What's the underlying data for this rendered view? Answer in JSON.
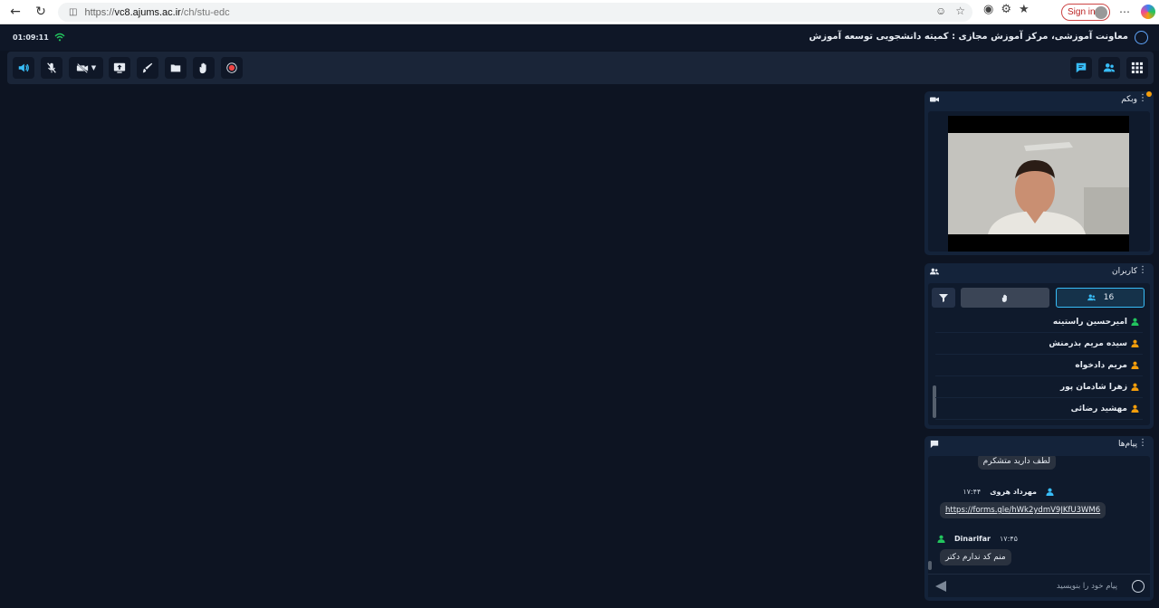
{
  "browser": {
    "url_scheme": "https://",
    "url_host": "vc8.ajums.ac.ir",
    "url_path": "/ch/stu-edc",
    "signin_label": "Sign in"
  },
  "header": {
    "timer": "01:09:11",
    "room_title": "معاونت آموزشی، مرکز آموزش مجازی : کمیته دانشجویی توسعه آموزش"
  },
  "panels": {
    "webcam": {
      "title": "وبکم"
    },
    "users": {
      "title": "کاربران",
      "count": "16",
      "list": [
        {
          "name": "امیرحسین راستینه",
          "status_color": "#22c55e"
        },
        {
          "name": "سیده مریم بذرمنش",
          "status_color": "#f59e0b"
        },
        {
          "name": "مریم دادخواه",
          "status_color": "#f59e0b"
        },
        {
          "name": "زهرا شادمان پور",
          "status_color": "#f59e0b"
        },
        {
          "name": "مهشید رضائی",
          "status_color": "#f59e0b"
        }
      ]
    },
    "messages": {
      "title": "پیام‌ها",
      "items": [
        {
          "text": "لطف دارید متشکرم"
        },
        {
          "author": "مهرداد هروی",
          "time": "۱۷:۴۴",
          "text": "https://forms.gle/hWk2ydmV9JKfU3WM6",
          "author_color": "#38bdf8"
        },
        {
          "author": "Dinarifar",
          "time": "۱۷:۴۵",
          "text": "منم کد ندارم دکتر",
          "author_color": "#22c55e"
        }
      ],
      "input_placeholder": "پیام خود را بنویسید"
    }
  },
  "colors": {
    "accent": "#38bdf8",
    "online": "#22c55e",
    "record": "#ef4444"
  }
}
